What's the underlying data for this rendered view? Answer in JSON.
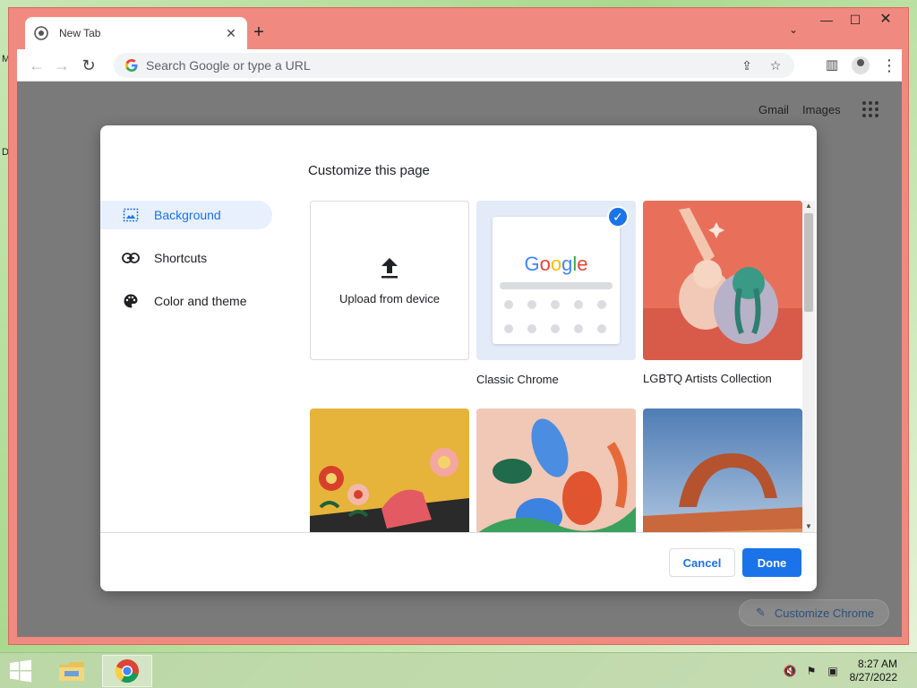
{
  "desktop": {
    "edge_letters": [
      "M",
      "D"
    ]
  },
  "browser": {
    "tab_title": "New Tab",
    "omnibox_placeholder": "Search Google or type a URL",
    "window_controls": {
      "minimize": "—",
      "maximize": "☐",
      "close": "✕"
    }
  },
  "ntp": {
    "gmail": "Gmail",
    "images": "Images",
    "customize_button": "Customize Chrome"
  },
  "dialog": {
    "title": "Customize this page",
    "nav": [
      {
        "label": "Background",
        "icon": "image-icon",
        "active": true
      },
      {
        "label": "Shortcuts",
        "icon": "link-icon",
        "active": false
      },
      {
        "label": "Color and theme",
        "icon": "palette-icon",
        "active": false
      }
    ],
    "tiles": {
      "upload_label": "Upload from device",
      "classic_label": "Classic Chrome",
      "classic_logo": "Google",
      "lgbtq_label": "LGBTQ Artists Collection"
    },
    "cancel": "Cancel",
    "done": "Done"
  },
  "taskbar": {
    "time": "8:27 AM",
    "date": "8/27/2022"
  },
  "colors": {
    "accent": "#1a73e8",
    "window_frame": "#f08a80"
  }
}
